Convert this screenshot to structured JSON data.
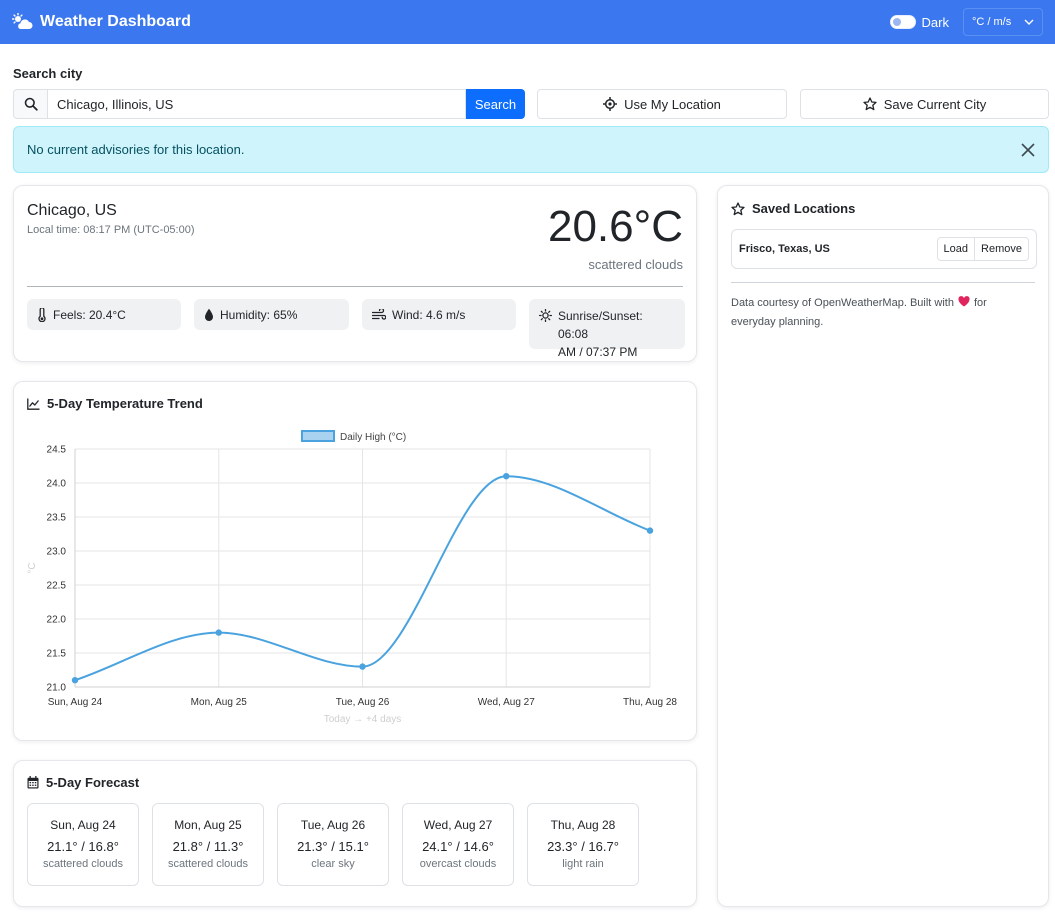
{
  "header": {
    "title": "Weather Dashboard",
    "dark_label": "Dark",
    "units_selected": "°C / m/s"
  },
  "search": {
    "label": "Search city",
    "value": "Chicago, Illinois, US",
    "button": "Search",
    "use_location": "Use My Location",
    "save_city": "Save Current City"
  },
  "advisory": {
    "text": "No current advisories for this location."
  },
  "current": {
    "city": "Chicago, US",
    "local_time": "Local time: 08:17 PM (UTC-05:00)",
    "temperature": "20.6°C",
    "description": "scattered clouds",
    "feels": "Feels: 20.4°C",
    "humidity": "Humidity: 65%",
    "wind": "Wind: 4.6 m/s",
    "sun_line1": "Sunrise/Sunset: 06:08",
    "sun_line2": "AM / 07:37 PM"
  },
  "trend": {
    "title": "5-Day Temperature Trend"
  },
  "chart_data": {
    "type": "line",
    "categories": [
      "Sun, Aug 24",
      "Mon, Aug 25",
      "Tue, Aug 26",
      "Wed, Aug 27",
      "Thu, Aug 28"
    ],
    "series": [
      {
        "name": "Daily High (°C)",
        "values": [
          21.1,
          21.8,
          21.3,
          24.1,
          23.3
        ]
      }
    ],
    "xlabel": "Today → +4 days",
    "ylabel": "°C",
    "ylim": [
      21.0,
      24.5
    ],
    "yticks": [
      24.5,
      24.0,
      23.5,
      23.0,
      22.5,
      22.0,
      21.5,
      21.0
    ],
    "grid": true,
    "legend": "top",
    "color": "#4aa3df"
  },
  "forecast": {
    "title": "5-Day Forecast",
    "days": [
      {
        "day": "Sun, Aug 24",
        "temps": "21.1° / 16.8°",
        "desc": "scattered clouds"
      },
      {
        "day": "Mon, Aug 25",
        "temps": "21.8° / 11.3°",
        "desc": "scattered clouds"
      },
      {
        "day": "Tue, Aug 26",
        "temps": "21.3° / 15.1°",
        "desc": "clear sky"
      },
      {
        "day": "Wed, Aug 27",
        "temps": "24.1° / 14.6°",
        "desc": "overcast clouds"
      },
      {
        "day": "Thu, Aug 28",
        "temps": "23.3° / 16.7°",
        "desc": "light rain"
      }
    ]
  },
  "saved": {
    "title": "Saved Locations",
    "items": [
      {
        "name": "Frisco, Texas, US",
        "load": "Load",
        "remove": "Remove"
      }
    ],
    "credit_before": "Data courtesy of OpenWeatherMap. Built with",
    "credit_after": "for everyday planning."
  },
  "colors": {
    "primary": "#3b78f0",
    "button": "#0d6efd",
    "alert_bg": "#cff4fc",
    "heart": "#e0245e"
  }
}
